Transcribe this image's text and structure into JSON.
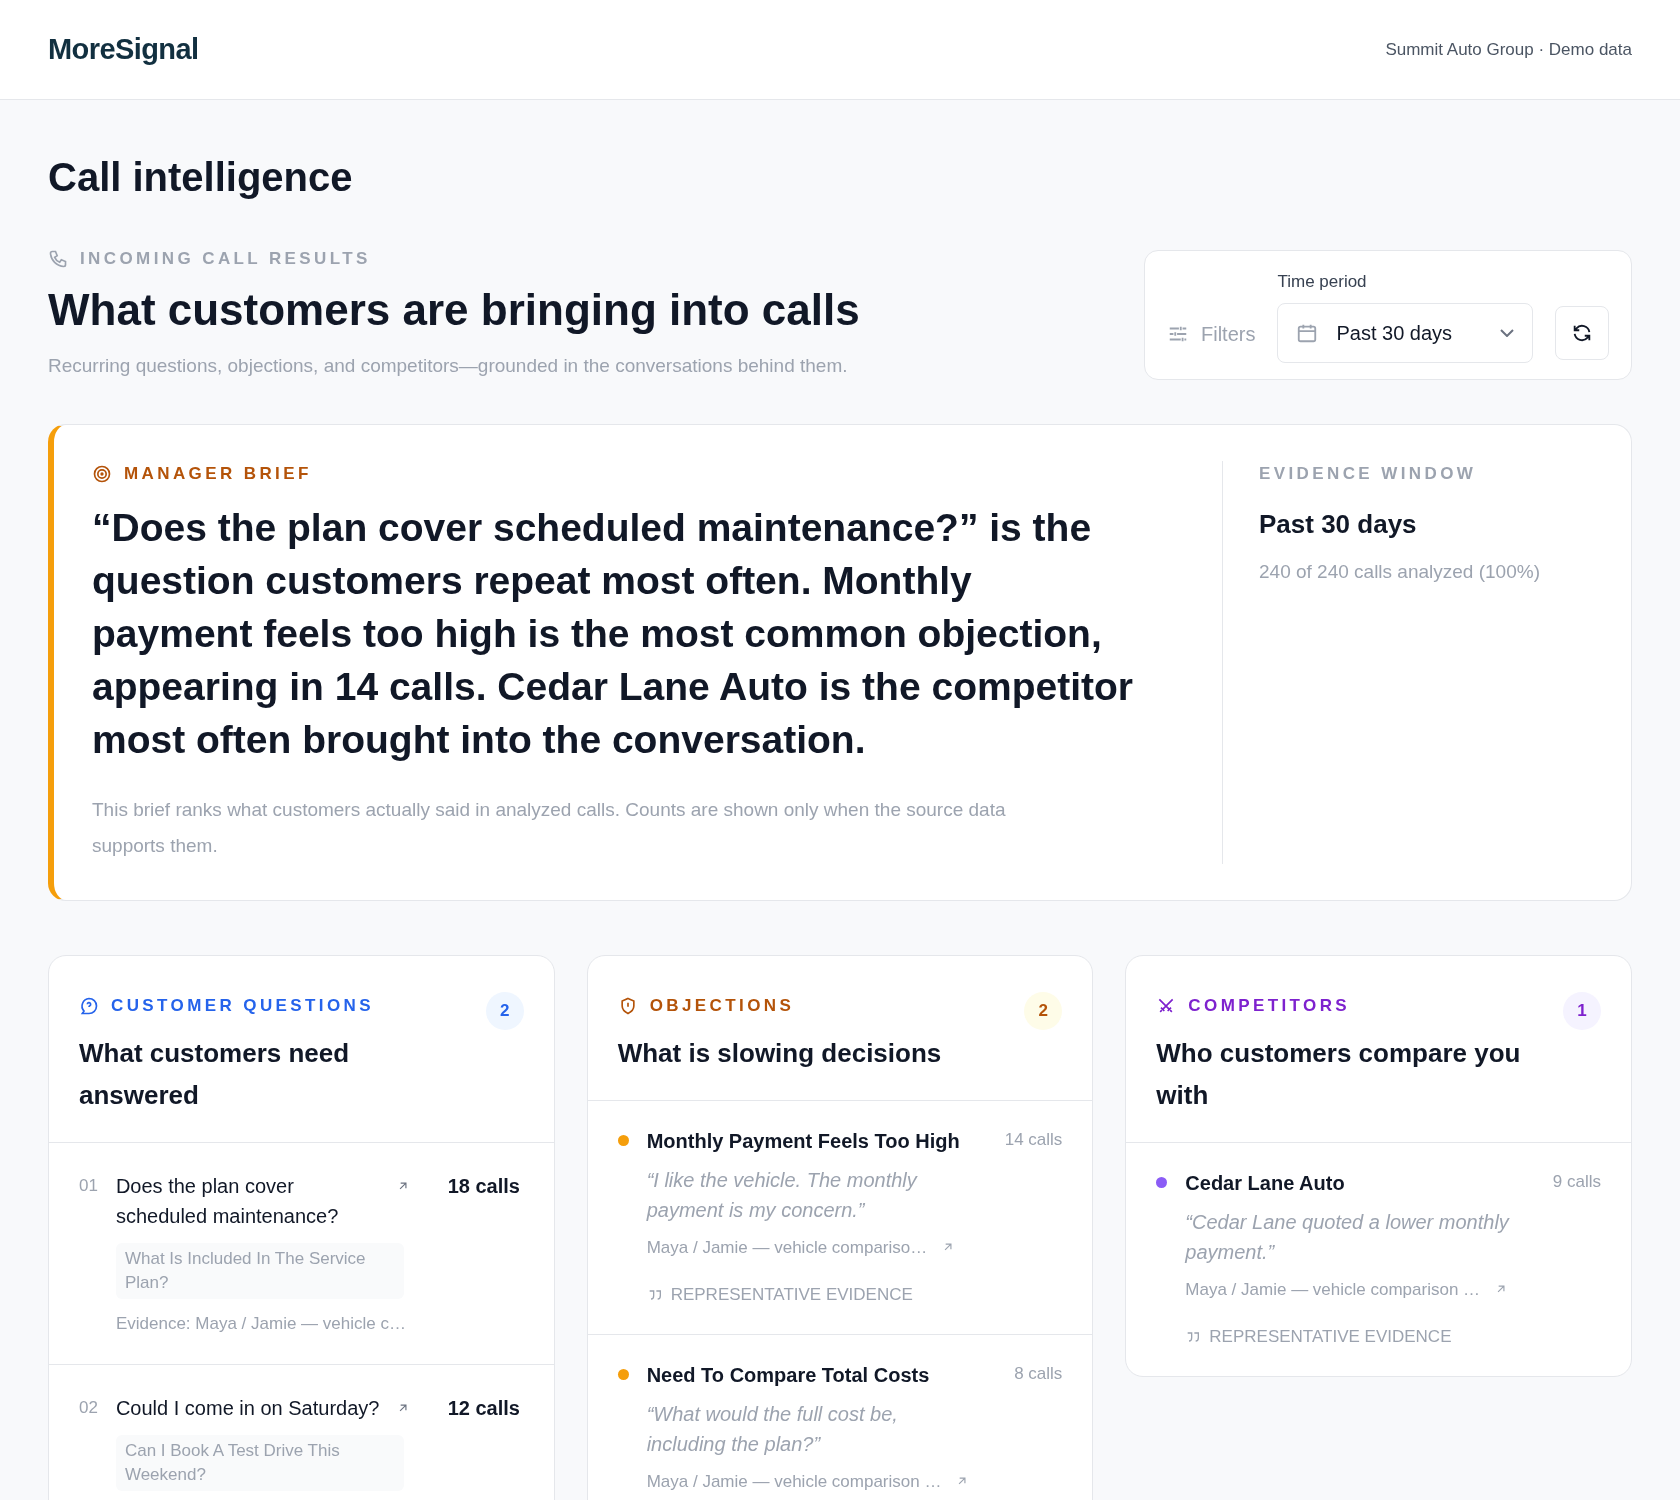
{
  "header": {
    "logo": "MoreSignal",
    "account": "Summit Auto Group · Demo data"
  },
  "page_title": "Call intelligence",
  "hero": {
    "eyebrow": "INCOMING CALL RESULTS",
    "title": "What customers are bringing into calls",
    "subtitle": "Recurring questions, objections, and competitors—grounded in the conversations behind them."
  },
  "controls": {
    "filters_label": "Filters",
    "time_period_label": "Time period",
    "time_period_value": "Past 30 days"
  },
  "brief": {
    "eyebrow": "MANAGER BRIEF",
    "text": "“Does the plan cover scheduled maintenance?” is the question customers repeat most often. Monthly payment feels too high is the most common objection, appearing in 14 calls. Cedar Lane Auto is the competitor most often brought into the conversation.",
    "note": "This brief ranks what customers actually said in analyzed calls. Counts are shown only when the source data supports them.",
    "evidence_label": "EVIDENCE WINDOW",
    "evidence_period": "Past 30 days",
    "evidence_detail": "240 of 240 calls analyzed (100%)"
  },
  "panels": [
    {
      "kind": "questions",
      "eyebrow": "CUSTOMER QUESTIONS",
      "count": "2",
      "title": "What customers need answered",
      "color": "#2563eb",
      "items": [
        {
          "rank": "01",
          "question": "Does the plan cover scheduled maintenance?",
          "calls": "18 calls",
          "variant": "What Is Included In The Service Plan?",
          "evidence": "Evidence: Maya / Jamie — vehicle c…"
        },
        {
          "rank": "02",
          "question": "Could I come in on Saturday?",
          "calls": "12 calls",
          "variant": "Can I Book A Test Drive This Weekend?"
        }
      ]
    },
    {
      "kind": "objections",
      "eyebrow": "OBJECTIONS",
      "count": "2",
      "title": "What is slowing decisions",
      "color": "#b45309",
      "items": [
        {
          "name": "Monthly Payment Feels Too High",
          "calls": "14 calls",
          "quote": "“I like the vehicle. The monthly payment is my concern.”",
          "source": "Maya / Jamie — vehicle compariso…",
          "tag": "REPRESENTATIVE EVIDENCE",
          "color": "#f59e0b"
        },
        {
          "name": "Need To Compare Total Costs",
          "calls": "8 calls",
          "quote": "“What would the full cost be, including the plan?”",
          "source": "Maya / Jamie — vehicle comparison …",
          "color": "#f59e0b"
        }
      ]
    },
    {
      "kind": "competitors",
      "eyebrow": "COMPETITORS",
      "count": "1",
      "title": "Who customers compare you with",
      "color": "#7e22ce",
      "items": [
        {
          "name": "Cedar Lane Auto",
          "calls": "9 calls",
          "quote": "“Cedar Lane quoted a lower monthly payment.”",
          "source": "Maya / Jamie — vehicle comparison …",
          "tag": "REPRESENTATIVE EVIDENCE",
          "color": "#8b5cf6"
        }
      ]
    }
  ]
}
